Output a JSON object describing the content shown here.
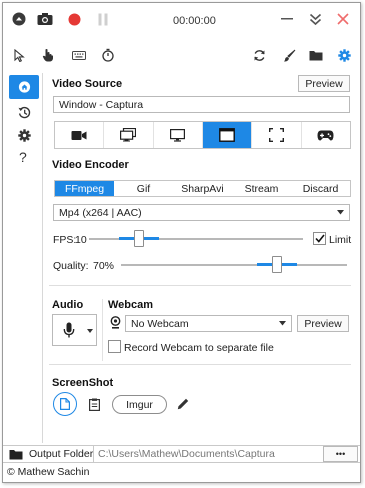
{
  "titlebar": {
    "timer": "00:00:00",
    "icons": [
      "menu-circle-icon",
      "camera-icon",
      "record-icon",
      "pause-icon",
      "minimize-icon",
      "collapse-icon",
      "close-icon"
    ]
  },
  "toolbar": {
    "icons": [
      "cursor-icon",
      "hand-icon",
      "keyboard-icon",
      "stopwatch-icon",
      "refresh-icon",
      "brush-icon",
      "folder-icon",
      "gear-icon"
    ]
  },
  "nav": {
    "items": [
      "home-icon",
      "history-icon",
      "settings-icon",
      "help-icon"
    ],
    "help_label": "?"
  },
  "video_source": {
    "title": "Video Source",
    "preview_label": "Preview",
    "current_value": "Window  -  Captura",
    "sources": [
      "video-camera-icon",
      "screens-icon",
      "monitor-icon",
      "window-icon",
      "region-icon",
      "gamepad-icon"
    ],
    "selected_index": 3
  },
  "video_encoder": {
    "title": "Video Encoder",
    "tabs": [
      "FFmpeg",
      "Gif",
      "SharpAvi",
      "Stream",
      "Discard"
    ],
    "selected_tab": "FFmpeg",
    "codec": "Mp4 (x264 | AAC)",
    "fps_label": "FPS:",
    "fps_value": "10",
    "fps_fraction": 0.22,
    "limit_label": "Limit",
    "limit_checked": true,
    "quality_label": "Quality:",
    "quality_value": "70%",
    "quality_fraction": 0.7
  },
  "audio": {
    "title": "Audio"
  },
  "webcam": {
    "title": "Webcam",
    "selected": "No Webcam",
    "preview_label": "Preview",
    "separate_label": "Record Webcam to separate file",
    "separate_checked": false
  },
  "screenshot": {
    "title": "ScreenShot",
    "imgur_label": "Imgur"
  },
  "footer": {
    "output_label": "Output Folder",
    "output_path": "C:\\Users\\Mathew\\Documents\\Captura",
    "more_label": "•••",
    "copyright": "© Mathew Sachin"
  },
  "colors": {
    "accent": "#1e88e5",
    "record": "#e53935",
    "close": "#ef6c6c"
  }
}
